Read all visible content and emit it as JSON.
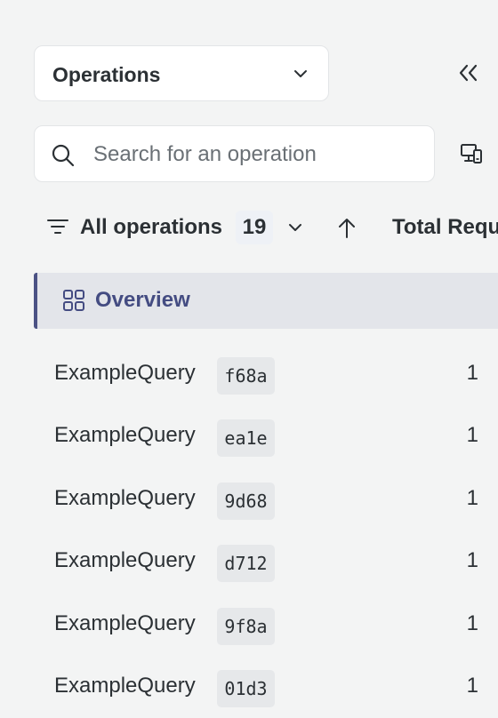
{
  "selector": {
    "label": "Operations"
  },
  "search": {
    "placeholder": "Search for an operation",
    "value": ""
  },
  "filter": {
    "label": "All operations",
    "count": "19",
    "sort_column": "Total Requ"
  },
  "overview": {
    "label": "Overview"
  },
  "operations": [
    {
      "name": "ExampleQuery",
      "hash": "f68a",
      "value": "1"
    },
    {
      "name": "ExampleQuery",
      "hash": "ea1e",
      "value": "1"
    },
    {
      "name": "ExampleQuery",
      "hash": "9d68",
      "value": "1"
    },
    {
      "name": "ExampleQuery",
      "hash": "d712",
      "value": "1"
    },
    {
      "name": "ExampleQuery",
      "hash": "9f8a",
      "value": "1"
    },
    {
      "name": "ExampleQuery",
      "hash": "01d3",
      "value": "1"
    }
  ],
  "colors": {
    "background": "#f3f4f4",
    "accent": "#444c82",
    "selected_bg": "#e3e5ea"
  }
}
